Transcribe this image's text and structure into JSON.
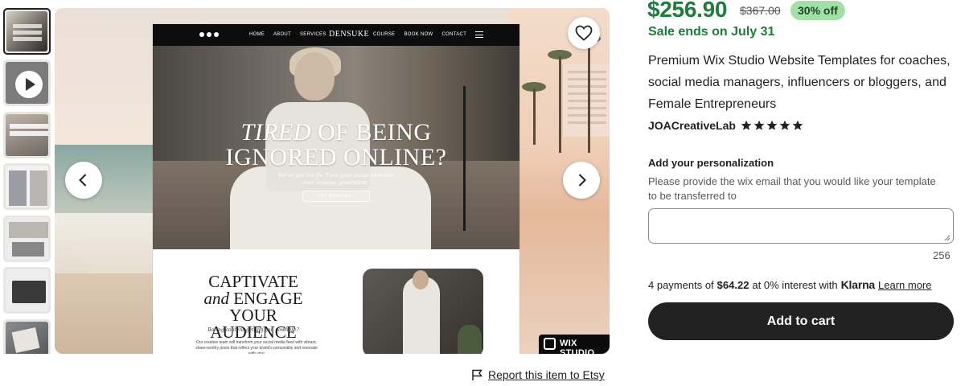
{
  "gallery": {
    "thumbnails": [
      "thumb-1",
      "video-thumb",
      "thumb-3",
      "thumb-4",
      "thumb-5",
      "thumb-6",
      "thumb-7"
    ],
    "mockup": {
      "nav_left": [
        "HOME",
        "ABOUT",
        "SERVICES"
      ],
      "brand": "DENSUKE",
      "nav_right": [
        "COURSE",
        "BOOK NOW",
        "CONTACT"
      ],
      "hero_title_line1_italic": "TIRED",
      "hero_title_line1_rest": " OF BEING",
      "hero_title_line2": "IGNORED ONLINE?",
      "hero_subtitle": "We've got the fix. Turn your social channels into revenue generators.",
      "hero_button": "GET STARTED  ›",
      "captivate_line1": "CAPTIVATE",
      "captivate_and": "and",
      "captivate_engage": " ENGAGE",
      "captivate_line3": "YOUR AUDIENCE",
      "captivate_sub": "Boring content getting you nowhere?",
      "captivate_body": "Our creative team will transform your social media feed with vibrant, share-worthy posts that reflect your brand's personality and resonate with your"
    },
    "badge": "WIX STUDIO",
    "report_link": "Report this item to Etsy"
  },
  "listing": {
    "price": "$256.90",
    "original_price": "$367.00",
    "discount": "30% off",
    "sale_ends": "Sale ends on July 31",
    "title": "Premium Wix Studio Website Templates for coaches, social media managers, influencers or bloggers, and Female Entrepreneurs",
    "shop_name": "JOACreativeLab",
    "rating_stars": 5,
    "personalization_label": "Add your personalization",
    "personalization_help": "Please provide the wix email that you would like your template to be transferred to",
    "personalization_value": "",
    "char_counter": "256",
    "klarna_prefix": "4 payments of",
    "klarna_amount": "$64.22",
    "klarna_mid": "at 0% interest with",
    "klarna_brand": "Klarna",
    "klarna_link": "Learn more",
    "add_to_cart": "Add to cart"
  },
  "colors": {
    "price_green": "#1e7d3b",
    "badge_green": "#a2e0a8",
    "cart_button": "#222222"
  },
  "icons": {
    "favorite": "heart-icon",
    "previous": "chevron-left-icon",
    "next": "chevron-right-icon",
    "report": "flag-icon",
    "video": "play-icon",
    "rating": "star-icon"
  }
}
